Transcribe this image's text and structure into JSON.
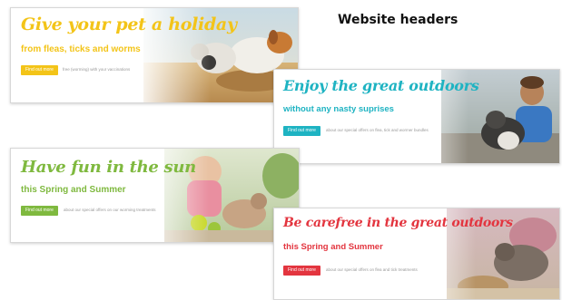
{
  "page": {
    "title": "Website headers"
  },
  "colors": {
    "yellow": "#f3c418",
    "teal": "#1eb3c2",
    "green": "#7fb93f",
    "red": "#e3353f"
  },
  "banners": [
    {
      "headline": "Give your pet a holiday",
      "subline": "from fleas, ticks and worms",
      "cta": "Find out more",
      "note": "free (worming) with your vaccinations",
      "image": "dogs-digging-beach"
    },
    {
      "headline": "Enjoy the great outdoors",
      "subline": "without any nasty suprises",
      "cta": "Find out more",
      "note": "about our special offers on flea, tick and wormer bundles",
      "image": "boy-with-dog"
    },
    {
      "headline": "Have fun in the sun",
      "subline": "this Spring and Summer",
      "cta": "Find out more",
      "note": "about our special offers on our worming treatments",
      "image": "child-with-cat"
    },
    {
      "headline": "Be carefree in the great outdoors",
      "subline": "this Spring and Summer",
      "cta": "Find out more",
      "note": "about our special offers on flea and tick treatments",
      "image": "cat-in-garden"
    }
  ]
}
